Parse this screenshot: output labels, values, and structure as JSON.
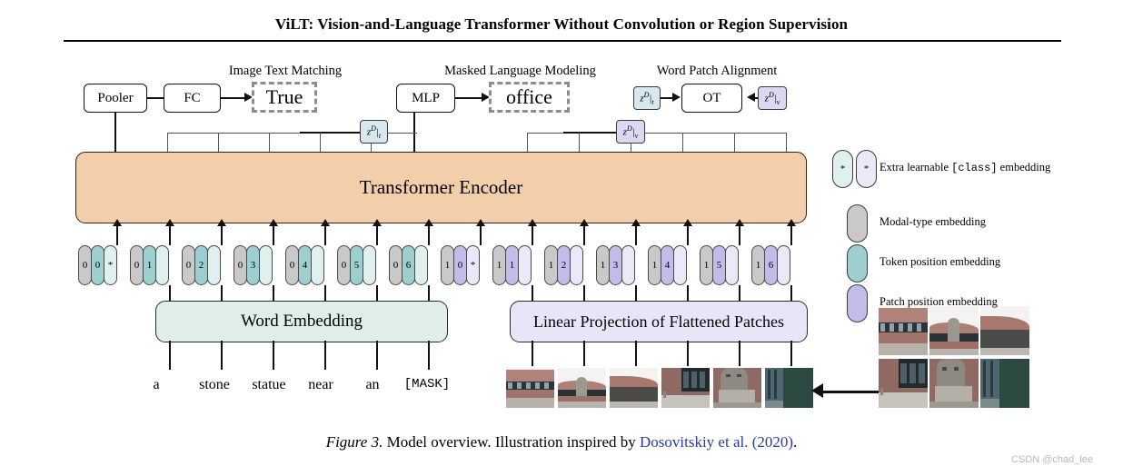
{
  "paper": {
    "title": "ViLT: Vision-and-Language Transformer Without Convolution or Region Supervision"
  },
  "heads": {
    "itm": {
      "label": "Image Text Matching",
      "pooler": "Pooler",
      "fc": "FC",
      "output": "True"
    },
    "mlm": {
      "label": "Masked Language Modeling",
      "mlp": "MLP",
      "output": "office"
    },
    "wpa": {
      "label": "Word Patch Alignment",
      "ot": "OT",
      "left_chip": {
        "base": "z",
        "sup": "D",
        "sub": "t"
      },
      "right_chip": {
        "base": "z",
        "sup": "D",
        "sub": "v"
      }
    }
  },
  "encoder": {
    "label": "Transformer Encoder"
  },
  "output_chips": {
    "text": {
      "base": "z",
      "sup": "D",
      "sub": "t"
    },
    "visual": {
      "base": "z",
      "sup": "D",
      "sub": "v"
    }
  },
  "embeddings": {
    "word_embedding": "Word Embedding",
    "linear_projection": "Linear Projection of Flattened Patches",
    "text_tokens": [
      {
        "modal": "0",
        "pos": "0",
        "extra": "*"
      },
      {
        "modal": "0",
        "pos": "1",
        "extra": ""
      },
      {
        "modal": "0",
        "pos": "2",
        "extra": ""
      },
      {
        "modal": "0",
        "pos": "3",
        "extra": ""
      },
      {
        "modal": "0",
        "pos": "4",
        "extra": ""
      },
      {
        "modal": "0",
        "pos": "5",
        "extra": ""
      },
      {
        "modal": "0",
        "pos": "6",
        "extra": ""
      }
    ],
    "patch_tokens": [
      {
        "modal": "1",
        "pos": "0",
        "extra": "*"
      },
      {
        "modal": "1",
        "pos": "1",
        "extra": ""
      },
      {
        "modal": "1",
        "pos": "2",
        "extra": ""
      },
      {
        "modal": "1",
        "pos": "3",
        "extra": ""
      },
      {
        "modal": "1",
        "pos": "4",
        "extra": ""
      },
      {
        "modal": "1",
        "pos": "5",
        "extra": ""
      },
      {
        "modal": "1",
        "pos": "6",
        "extra": ""
      }
    ],
    "words": [
      "a",
      "stone",
      "statue",
      "near",
      "an",
      "[MASK]"
    ]
  },
  "legend": [
    {
      "text_prefix": "Extra learnable ",
      "mono": "[class]",
      "text_suffix": " embedding",
      "pills": 2,
      "colors": [
        "#dff0ef",
        "#ebe8f8"
      ],
      "glyph": "*"
    },
    {
      "text_prefix": "Modal-type embedding",
      "mono": "",
      "text_suffix": "",
      "pills": 1,
      "colors": [
        "#c9c9c9"
      ],
      "glyph": ""
    },
    {
      "text_prefix": "Token position embedding",
      "mono": "",
      "text_suffix": "",
      "pills": 1,
      "colors": [
        "#9ecfd0"
      ],
      "glyph": ""
    },
    {
      "text_prefix": "Patch position embedding",
      "mono": "",
      "text_suffix": "",
      "pills": 1,
      "colors": [
        "#c1bde8"
      ],
      "glyph": ""
    }
  ],
  "caption": {
    "figure": "Figure 3.",
    "text": " Model overview. Illustration inspired by ",
    "cite": "Dosovitskiy et al. (2020)",
    "period": "."
  },
  "watermark": "CSDN @chad_lee",
  "colors": {
    "encoder_fill": "#f3ceab",
    "word_embed_fill": "#dfeeea",
    "linear_proj_fill": "#e9e4f7",
    "modal_type": "#c9c9c9",
    "token_pos": "#9ecfd0",
    "patch_pos": "#c1bde8",
    "cite_link": "#2a3b9e"
  }
}
